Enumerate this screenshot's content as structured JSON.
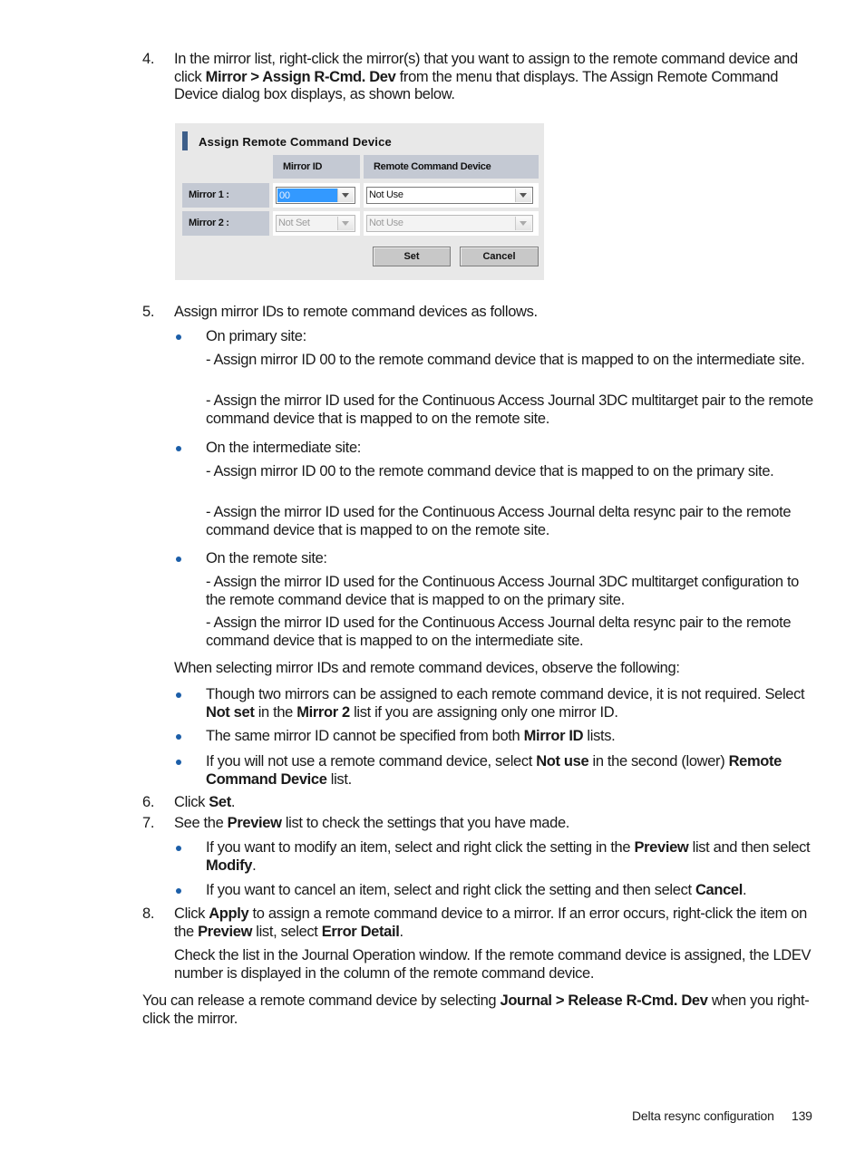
{
  "step4": {
    "num": "4.",
    "t1": "In the mirror list, right-click the mirror(s) that you want to assign to the remote command device and click ",
    "b1": "Mirror > Assign R-Cmd. Dev",
    "t2": " from the menu that displays. The Assign Remote Command Device dialog box displays, as shown below."
  },
  "dialog": {
    "title": "Assign Remote Command Device",
    "col_mirror_id": "Mirror ID",
    "col_rcd": "Remote Command Device",
    "rows": [
      {
        "label": "Mirror 1 :",
        "mirror_id": "00",
        "rcd": "Not Use",
        "enabled": true
      },
      {
        "label": "Mirror 2 :",
        "mirror_id": "Not Set",
        "rcd": "Not Use",
        "enabled": false
      }
    ],
    "set_label": "Set",
    "cancel_label": "Cancel"
  },
  "step5": {
    "num": "5.",
    "text": "Assign mirror IDs to remote command devices as follows.",
    "sites": [
      {
        "title": "On primary site:",
        "items": [
          "- Assign mirror ID 00 to the remote command device that is mapped to on the intermediate site.",
          "- Assign the mirror ID used for the Continuous Access Journal 3DC multitarget pair to the remote command device that is mapped to on the remote site."
        ]
      },
      {
        "title": "On the intermediate site:",
        "items": [
          "- Assign mirror ID 00 to the remote command device that is mapped to on the primary site.",
          "- Assign the mirror ID used for the Continuous Access Journal delta resync pair to the remote command device that is mapped to on the remote site."
        ]
      },
      {
        "title": "On the remote site:",
        "items": [
          "- Assign the mirror ID used for the Continuous Access Journal 3DC multitarget configuration to the remote command device that is mapped to on the primary site.",
          "- Assign the mirror ID used for the Continuous Access Journal delta resync pair to the remote command device that is mapped to on the intermediate site."
        ]
      }
    ],
    "observe": "When selecting mirror IDs and remote command devices, observe the following:",
    "notes": [
      {
        "t1": "Though two mirrors can be assigned to each remote command device, it is not required. Select ",
        "b1": "Not set",
        "t2": " in the ",
        "b2": "Mirror 2",
        "t3": " list if you are assigning only one mirror ID."
      },
      {
        "t1": "The same mirror ID cannot be specified from both ",
        "b1": "Mirror ID",
        "t2": " lists."
      },
      {
        "t1": "If you will not use a remote command device, select ",
        "b1": "Not use",
        "t2": " in the second (lower) ",
        "b2": "Remote Command Device",
        "t3": " list."
      }
    ]
  },
  "step6": {
    "num": "6.",
    "t1": "Click ",
    "b1": "Set",
    "t2": "."
  },
  "step7": {
    "num": "7.",
    "t1": "See the ",
    "b1": "Preview",
    "t2": " list to check the settings that you have made.",
    "bullets": [
      {
        "t1": "If you want to modify an item, select and right click the setting in the ",
        "b1": "Preview",
        "t2": " list and then select ",
        "b2": "Modify",
        "t3": "."
      },
      {
        "t1": "If you want to cancel an item, select and right click the setting and then select ",
        "b1": "Cancel",
        "t2": "."
      }
    ]
  },
  "step8": {
    "num": "8.",
    "t1": "Click ",
    "b1": "Apply",
    "t2": " to assign a remote command device to a mirror. If an error occurs, right-click the item on the ",
    "b2": "Preview",
    "t3": " list, select ",
    "b3": "Error Detail",
    "t4": ".",
    "check": "Check the list in the Journal Operation window. If the remote command device is assigned, the LDEV number is displayed in the column of the remote command device."
  },
  "release": {
    "t1": "You can release a remote command device by selecting ",
    "b1": "Journal > Release R-Cmd. Dev",
    "t2": " when you right-click the mirror."
  },
  "footer": {
    "section": "Delta resync configuration",
    "page": "139"
  },
  "colors": {
    "bullet": "#1b5ea8",
    "dialog_header": "#c4c9d3",
    "selection": "#3399ff"
  }
}
